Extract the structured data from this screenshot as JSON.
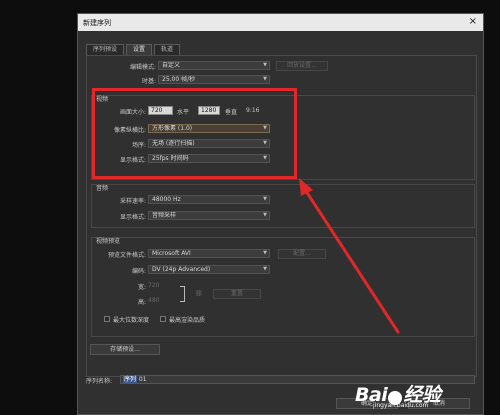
{
  "dialog": {
    "title": "新建序列",
    "close_glyph": "×"
  },
  "tabs": [
    {
      "label": "序列预设"
    },
    {
      "label": "设置"
    },
    {
      "label": "轨道"
    }
  ],
  "general": {
    "editing_mode_label": "编辑模式:",
    "editing_mode_value": "自定义",
    "playback_settings_button": "回放设置...",
    "timebase_label": "时基:",
    "timebase_value": "25.00 帧/秒"
  },
  "video": {
    "section_title": "视频",
    "frame_size_label": "画面大小:",
    "frame_width": "720",
    "horizontal_label": "水平",
    "frame_height": "1280",
    "vertical_label": "垂直",
    "aspect": "9:16",
    "pixel_aspect_label": "像素纵横比:",
    "pixel_aspect_value": "方形像素 (1.0)",
    "fields_label": "场序:",
    "fields_value": "无场 (逐行扫描)",
    "display_format_label": "显示格式:",
    "display_format_value": "25fps 时间码"
  },
  "audio": {
    "section_title": "音频",
    "sample_rate_label": "采样速率:",
    "sample_rate_value": "48000 Hz",
    "display_format_label": "显示格式:",
    "display_format_value": "音频采样"
  },
  "video_preview": {
    "section_title": "视频预览",
    "preview_file_format_label": "预览文件格式:",
    "preview_file_format_value": "Microsoft AVI",
    "configure_button": "配置...",
    "codec_label": "编码:",
    "codec_value": "DV (24p Advanced)",
    "width_label": "宽:",
    "width_value": "720",
    "height_label": "高:",
    "height_value": "480",
    "reset_button": "重置",
    "max_bit_depth_label": "最大位数深度",
    "max_render_quality_label": "最高渲染品质"
  },
  "save_preset_button": "存储预设...",
  "sequence_name_label": "序列名称:",
  "sequence_name_value_highlight": "序列",
  "sequence_name_value_rest": " 01",
  "ok_button": "确定",
  "cancel_button": "取消",
  "watermark": {
    "logo_left": "Bai",
    "logo_right": "经验",
    "subtitle": "jingyan.baidu.com"
  },
  "colors": {
    "annotation_red": "#e02828",
    "dialog_bg": "#303030",
    "titlebar_bg": "#e9e9e9"
  }
}
